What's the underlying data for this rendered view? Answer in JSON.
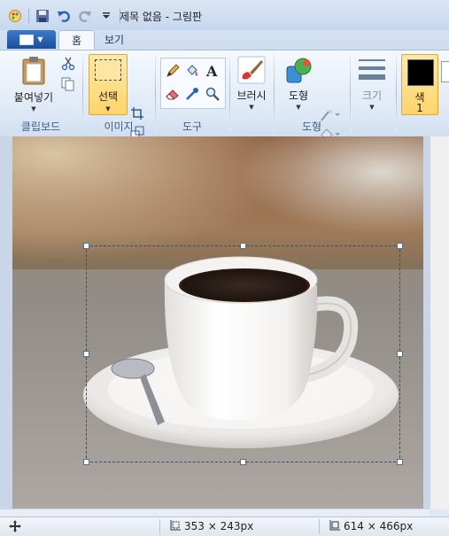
{
  "window": {
    "title": "제목 없음 - 그림판"
  },
  "tabs": [
    {
      "label": "홈",
      "active": true
    },
    {
      "label": "보기",
      "active": false
    }
  ],
  "ribbon": {
    "clipboard": {
      "group_label": "클립보드",
      "paste_label": "붙여넣기"
    },
    "image": {
      "group_label": "이미지",
      "select_label": "선택"
    },
    "tools": {
      "group_label": "도구"
    },
    "brushes": {
      "label": "브러시"
    },
    "shapes": {
      "group_label": "도형",
      "shapes_label": "도형"
    },
    "size": {
      "label": "크기"
    },
    "colors": {
      "color1_label": "색",
      "color1_number": "1",
      "color1_value": "#000000"
    }
  },
  "status": {
    "selection_size": "353 × 243px",
    "canvas_size": "614 × 466px"
  }
}
